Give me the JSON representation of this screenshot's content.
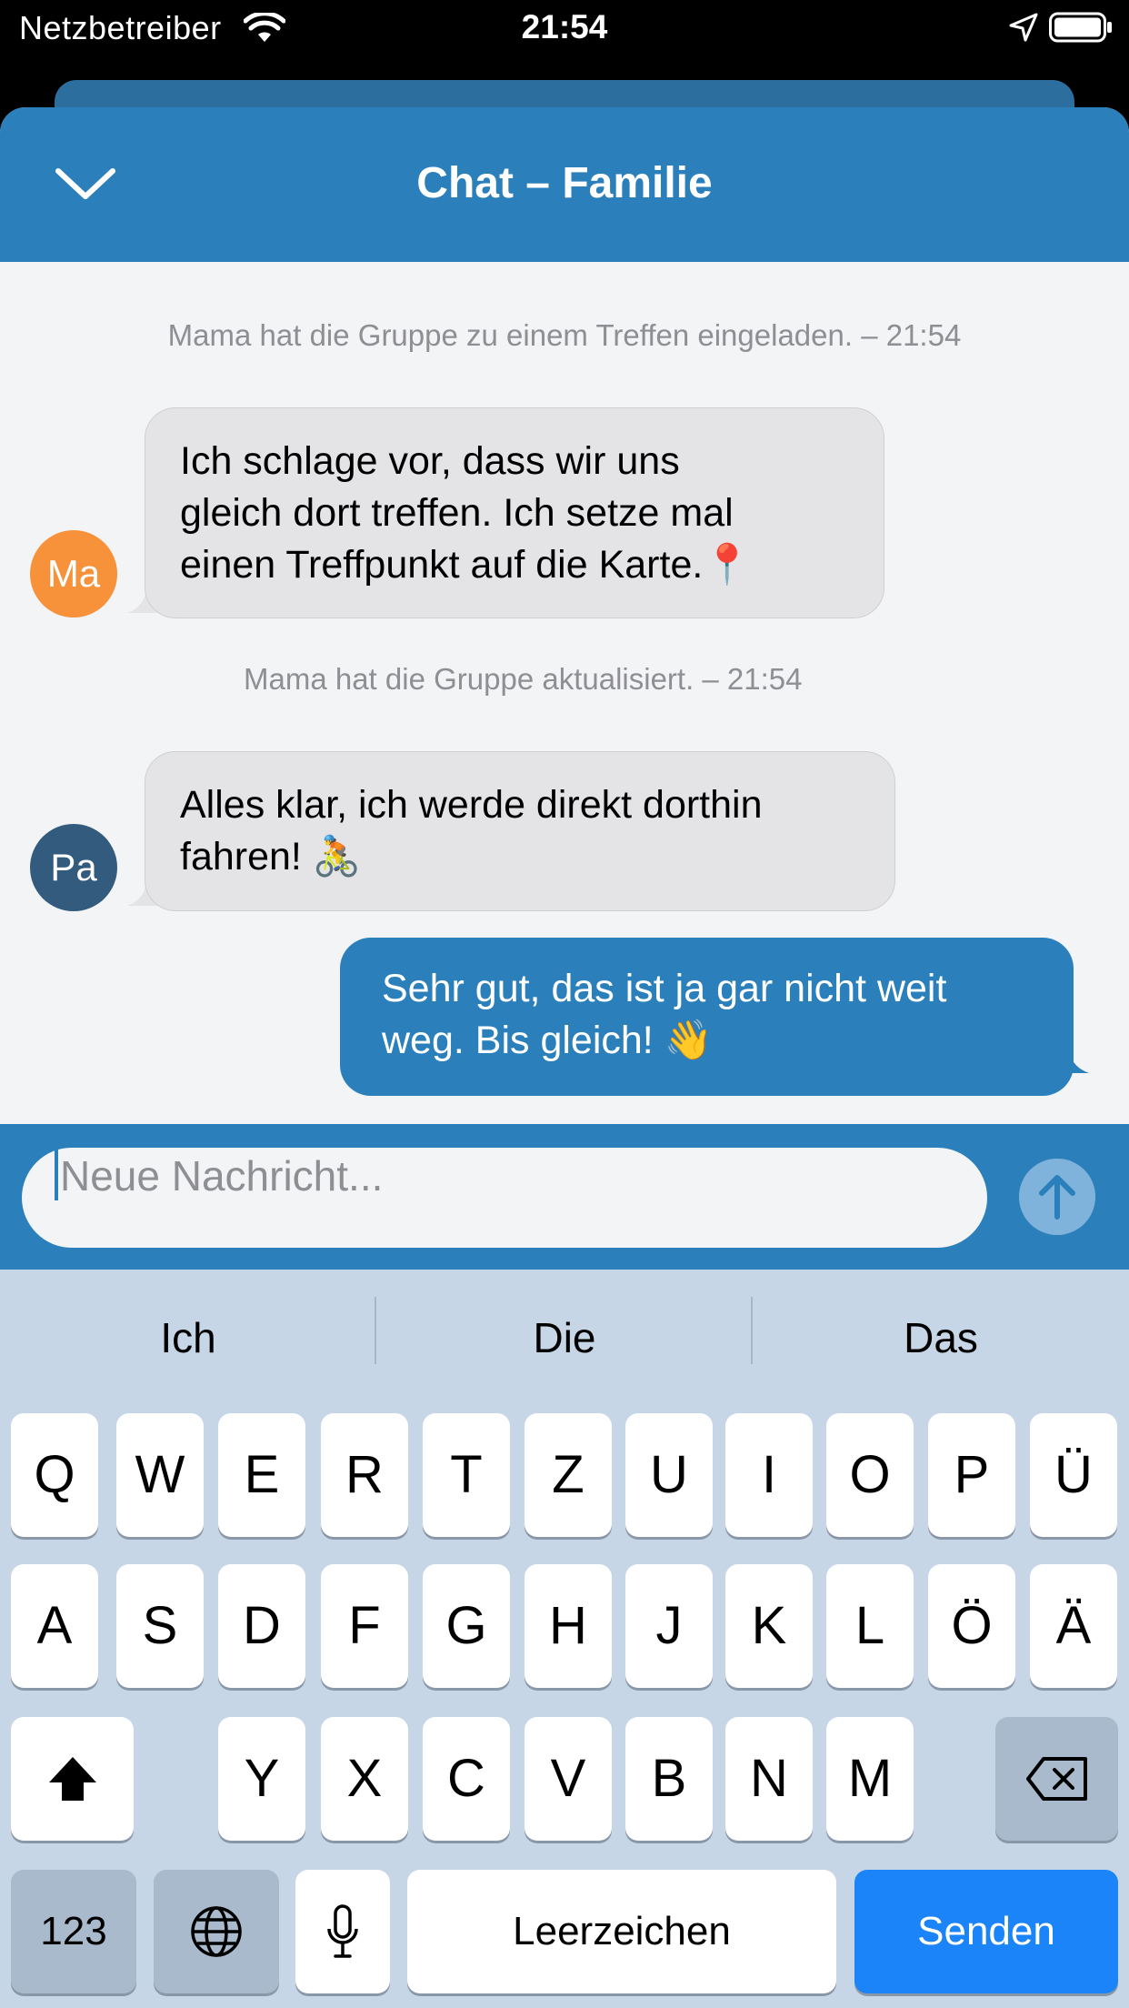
{
  "status_bar": {
    "carrier": "Netzbetreiber",
    "time": "21:54"
  },
  "header": {
    "title": "Chat – Familie"
  },
  "messages": {
    "system_1": "Mama hat die Gruppe zu einem Treffen eingeladen. – 21:54",
    "msg_1": {
      "avatar": "Ma",
      "avatar_color": "#f7923a",
      "lines": [
        "Ich schlage vor, dass wir uns",
        "gleich dort treffen. Ich setze mal",
        "einen Treffpunkt auf die Karte.📍"
      ]
    },
    "system_2": "Mama hat die Gruppe aktualisiert. – 21:54",
    "msg_2": {
      "avatar": "Pa",
      "avatar_color": "#335b7e",
      "lines": [
        "Alles klar, ich werde direkt dorthin",
        "fahren! 🚴"
      ]
    },
    "msg_3": {
      "lines": [
        "Sehr gut, das ist ja gar nicht weit",
        "weg. Bis gleich! 👋"
      ]
    }
  },
  "composer": {
    "placeholder": "Neue Nachricht...",
    "send_icon": "arrow-up-icon"
  },
  "keyboard": {
    "suggestions": [
      "Ich",
      "Die",
      "Das"
    ],
    "row1": [
      "Q",
      "W",
      "E",
      "R",
      "T",
      "Z",
      "U",
      "I",
      "O",
      "P",
      "Ü"
    ],
    "row2": [
      "A",
      "S",
      "D",
      "F",
      "G",
      "H",
      "J",
      "K",
      "L",
      "Ö",
      "Ä"
    ],
    "row3": [
      "Y",
      "X",
      "C",
      "V",
      "B",
      "N",
      "M"
    ],
    "numbers_label": "123",
    "space_label": "Leerzeichen",
    "send_label": "Senden"
  },
  "colors": {
    "accent": "#2b80bb",
    "send_key": "#1b84f8",
    "keyboard_bg": "#c6d6e6"
  }
}
